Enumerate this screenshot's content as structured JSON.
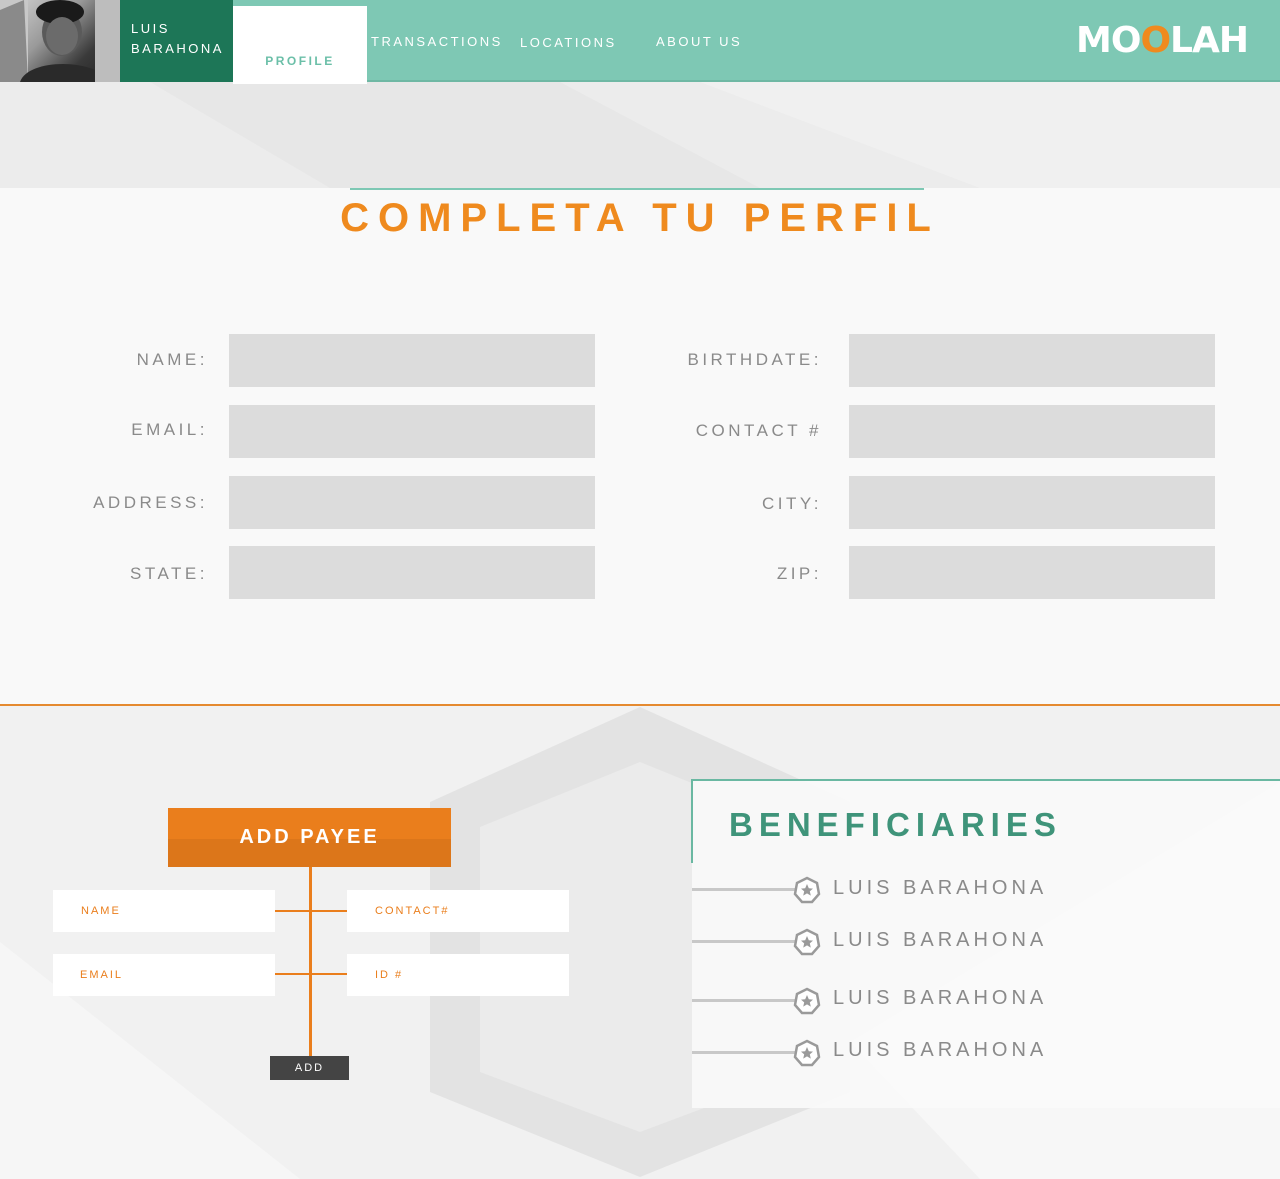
{
  "header": {
    "user_first": "LUIS",
    "user_last": "BARAHONA",
    "tabs": [
      {
        "label": "PROFILE",
        "active": true
      },
      {
        "label": "TRANSACTIONS"
      },
      {
        "label": "LOCATIONS"
      },
      {
        "label": "ABOUT  US"
      }
    ],
    "logo": {
      "part1": "MO",
      "part2": "O",
      "part3": "LAH"
    }
  },
  "profile_form": {
    "title": "COMPLETA TU PERFIL",
    "fields_left": [
      {
        "label": "NAME:",
        "value": ""
      },
      {
        "label": "EMAIL:",
        "value": ""
      },
      {
        "label": "ADDRESS:",
        "value": ""
      },
      {
        "label": "STATE:",
        "value": ""
      }
    ],
    "fields_right": [
      {
        "label": "BIRTHDATE:",
        "value": ""
      },
      {
        "label": "CONTACT #",
        "value": ""
      },
      {
        "label": "CITY:",
        "value": ""
      },
      {
        "label": "ZIP:",
        "value": ""
      }
    ]
  },
  "add_payee": {
    "title": "ADD PAYEE",
    "fields": [
      "NAME",
      "CONTACT#",
      "EMAIL",
      "ID #"
    ],
    "button": "ADD"
  },
  "beneficiaries": {
    "title": "BENEFICIARIES",
    "items": [
      "LUIS BARAHONA",
      "LUIS BARAHONA",
      "LUIS BARAHONA",
      "LUIS BARAHONA"
    ],
    "icon": "star-badge-icon"
  },
  "colors": {
    "header_teal": "#7ec8b4",
    "user_green": "#1d7657",
    "accent_orange": "#ea7e1c",
    "title_green": "#3f947a"
  }
}
